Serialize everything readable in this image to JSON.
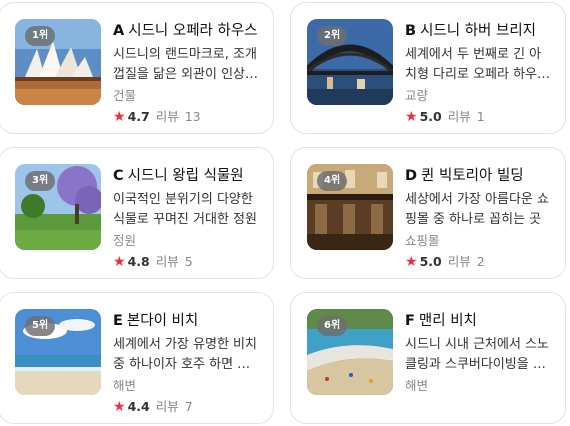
{
  "colors": {
    "star": "#e8333b",
    "badge": "#6e6e6e",
    "border": "#e3e3e3"
  },
  "places": [
    {
      "rank": "1위",
      "letter": "A",
      "name": "시드니 오페라 하우스",
      "desc": "시드니의 랜드마크로, 조개껍질을 닮은 외관이 인상적인 건축물",
      "category": "건물",
      "star": "★",
      "rating": "4.7",
      "review_label": "리뷰",
      "review_count": "13"
    },
    {
      "rank": "2위",
      "letter": "B",
      "name": "시드니 하버 브리지",
      "desc": "세계에서 두 번째로 긴 아치형 다리로 오페라 하우스와 함께 보이는 풍경",
      "category": "교량",
      "star": "★",
      "rating": "5.0",
      "review_label": "리뷰",
      "review_count": "1"
    },
    {
      "rank": "3위",
      "letter": "C",
      "name": "시드니 왕립 식물원",
      "desc": "이국적인 분위기의 다양한 식물로 꾸며진 거대한 정원",
      "category": "정원",
      "star": "★",
      "rating": "4.8",
      "review_label": "리뷰",
      "review_count": "5"
    },
    {
      "rank": "4위",
      "letter": "D",
      "name": "퀸 빅토리아 빌딩",
      "desc": "세상에서 가장 아름다운 쇼핑몰 중 하나로 꼽히는 곳",
      "category": "쇼핑몰",
      "star": "★",
      "rating": "5.0",
      "review_label": "리뷰",
      "review_count": "2"
    },
    {
      "rank": "5위",
      "letter": "E",
      "name": "본다이 비치",
      "desc": "세계에서 가장 유명한 비치 중 하나이자 호주 하면 떠오르는 해변",
      "category": "해변",
      "star": "★",
      "rating": "4.4",
      "review_label": "리뷰",
      "review_count": "7"
    },
    {
      "rank": "6위",
      "letter": "F",
      "name": "맨리 비치",
      "desc": "시드니 시내 근처에서 스노클링과 스쿠버다이빙을 즐길 수 있는 곳",
      "category": "해변"
    }
  ]
}
